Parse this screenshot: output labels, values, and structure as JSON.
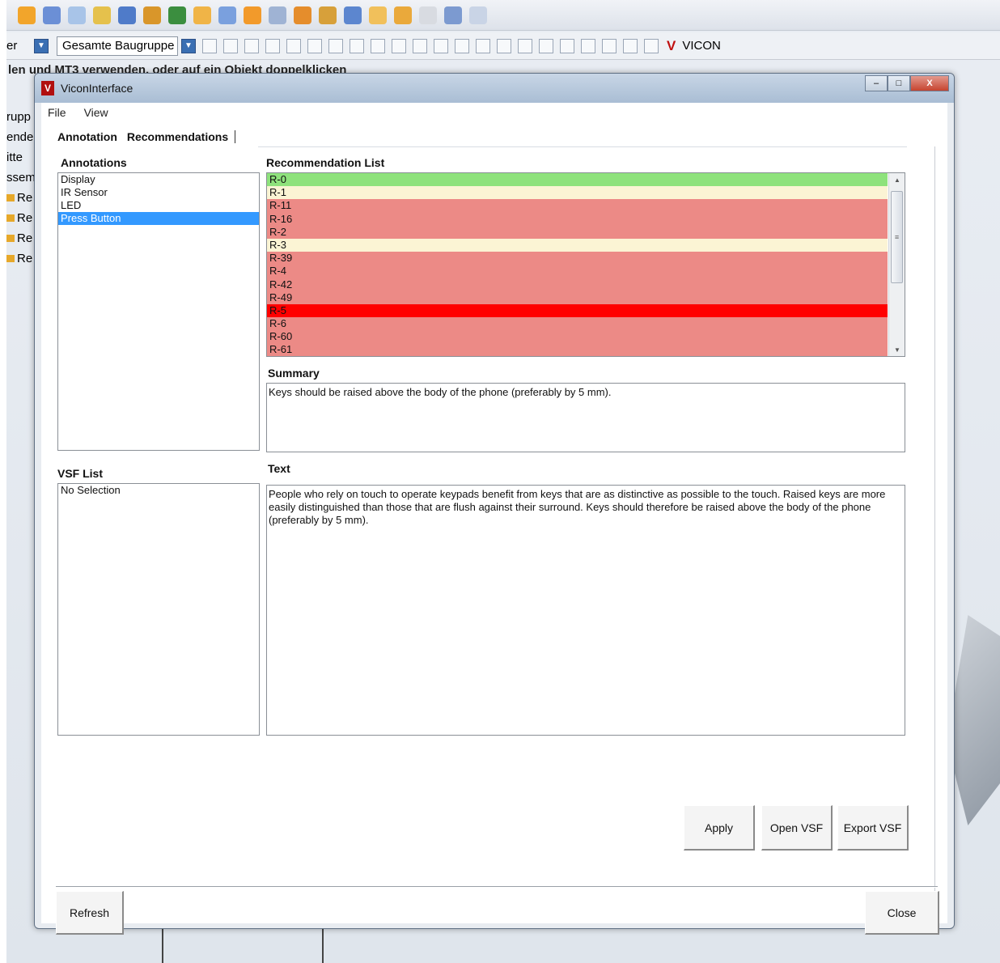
{
  "host": {
    "left_combo_text": "er",
    "assembly_combo": "Gesamte Baugruppe",
    "vicon_label": "VICON",
    "hint_text": "len und MT3 verwenden, oder auf ein Objekt doppelklicken",
    "tree_items": [
      "rupp",
      "ende",
      "itte",
      "ssem",
      "Re",
      "Re",
      "Re",
      "Re"
    ]
  },
  "window": {
    "title": "ViconInterface",
    "icon_letter": "V",
    "minimize": "–",
    "maximize": "□",
    "close": "X"
  },
  "menu": {
    "file": "File",
    "view": "View"
  },
  "tabs": {
    "annotation": "Annotation",
    "recommendations": "Recommendations"
  },
  "annotations": {
    "label": "Annotations",
    "items": [
      {
        "text": "Display",
        "selected": false
      },
      {
        "text": "IR Sensor",
        "selected": false
      },
      {
        "text": "LED",
        "selected": false
      },
      {
        "text": "Press Button",
        "selected": true
      }
    ]
  },
  "recommendations": {
    "label": "Recommendation List",
    "items": [
      {
        "id": "R-0",
        "color": "#8ee27c"
      },
      {
        "id": "R-1",
        "color": "#fbf4d4"
      },
      {
        "id": "R-11",
        "color": "#ec8a86"
      },
      {
        "id": "R-16",
        "color": "#ec8a86"
      },
      {
        "id": "R-2",
        "color": "#ec8a86"
      },
      {
        "id": "R-3",
        "color": "#fbf4d4"
      },
      {
        "id": "R-39",
        "color": "#ec8a86"
      },
      {
        "id": "R-4",
        "color": "#ec8a86"
      },
      {
        "id": "R-42",
        "color": "#ec8a86"
      },
      {
        "id": "R-49",
        "color": "#ec8a86"
      },
      {
        "id": "R-5",
        "color": "#ff0000"
      },
      {
        "id": "R-6",
        "color": "#ec8a86"
      },
      {
        "id": "R-60",
        "color": "#ec8a86"
      },
      {
        "id": "R-61",
        "color": "#ec8a86"
      }
    ]
  },
  "summary": {
    "label": "Summary",
    "text": "Keys should be raised above the body of the phone (preferably by 5 mm)."
  },
  "vsf": {
    "label": "VSF List",
    "items": [
      "No Selection"
    ]
  },
  "text_section": {
    "label": "Text",
    "text": "People who rely on touch to operate keypads benefit from keys that are as distinctive as possible to the touch. Raised keys are more easily distinguished than those that are flush against their surround. Keys should therefore be raised above the body of the phone (preferably by 5 mm)."
  },
  "buttons": {
    "apply": "Apply",
    "open_vsf": "Open VSF",
    "export_vsf": "Export VSF",
    "refresh": "Refresh",
    "close": "Close"
  }
}
